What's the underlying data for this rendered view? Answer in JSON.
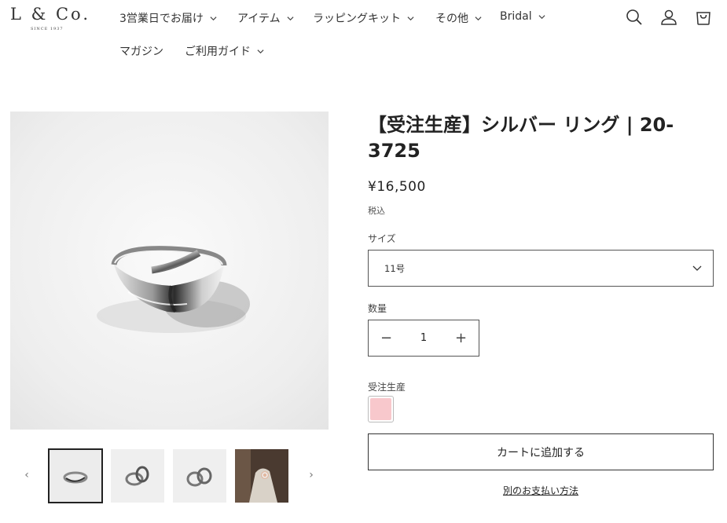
{
  "logo": {
    "text": "L & Co.",
    "sub": "SINCE 1937"
  },
  "nav": {
    "items": [
      {
        "label": "3営業日でお届け"
      },
      {
        "label": "アイテム"
      },
      {
        "label": "ラッピングキット"
      },
      {
        "label": "その他"
      },
      {
        "label": "Bridal"
      },
      {
        "label": "マガジン"
      },
      {
        "label": "ご利用ガイド"
      }
    ]
  },
  "header_icons": [
    "search-icon",
    "account-icon",
    "cart-icon"
  ],
  "product": {
    "title": "【受注生産】シルバー リング | 20-3725",
    "price": "¥16,500",
    "tax_note": "税込",
    "size_label": "サイズ",
    "size_value": "11号",
    "qty_label": "数量",
    "qty_value": "1",
    "qty_minus": "−",
    "qty_plus": "+",
    "variant_label": "受注生産",
    "swatch_color": "#f8c8cc",
    "add_to_cart": "カートに追加する",
    "other_payment": "別のお支払い方法"
  },
  "gallery": {
    "prev": "‹",
    "next": "›",
    "thumb_count": 4,
    "active_thumb": 0
  },
  "colors": {
    "text": "#222222",
    "border": "#555555",
    "swatch": "#f8c8cc"
  }
}
